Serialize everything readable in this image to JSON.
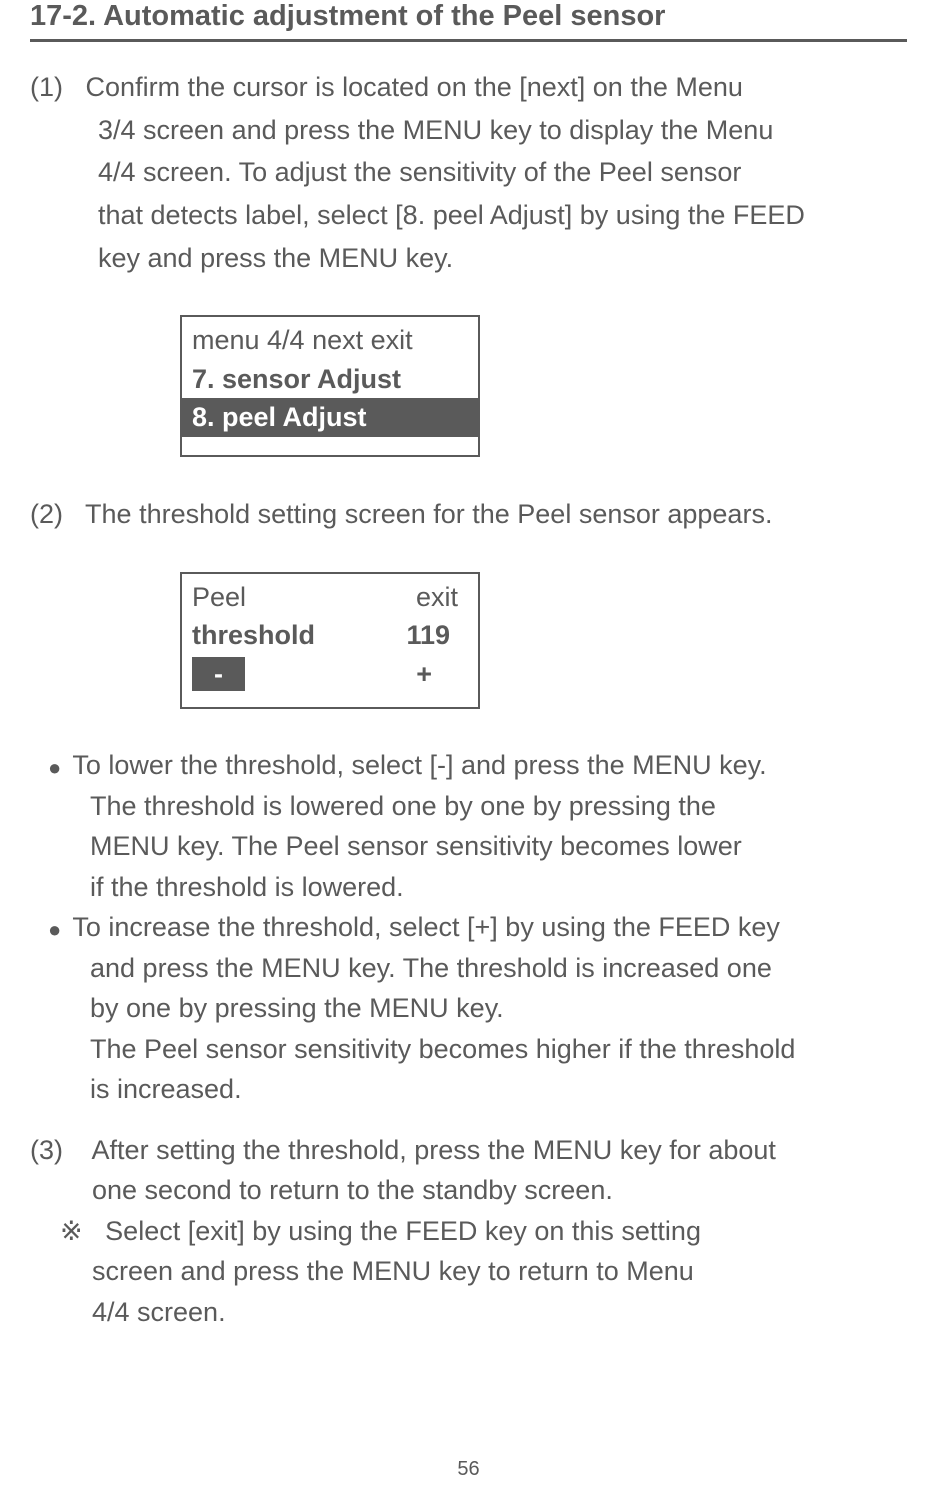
{
  "heading": "17-2.  Automatic adjustment of the Peel sensor",
  "step1": {
    "num": "(1)",
    "line1": "Confirm the cursor is located on the [next] on the  Menu",
    "line2": "3/4 screen and press the MENU key to display the Menu",
    "line3": "4/4 screen.  To adjust the sensitivity of the Peel sensor",
    "line4": "that detects label, select [8. peel Adjust] by using the FEED",
    "line5": "key and press the MENU key."
  },
  "screen1": {
    "row1": "menu 4/4 next   exit",
    "row2": "7. sensor Adjust",
    "row3": "8. peel Adjust"
  },
  "step2": {
    "num": "(2)",
    "line1": "The threshold setting screen for the Peel sensor appears."
  },
  "screen2": {
    "peel": "Peel",
    "exit": "exit",
    "threshold": "threshold",
    "value": "119",
    "minus": "-",
    "plus": "+"
  },
  "bullets": {
    "b1_l1": "To lower the threshold, select [-] and press the MENU key.",
    "b1_l2": "The threshold is lowered one by one by pressing the",
    "b1_l3": "MENU key.  The Peel sensor sensitivity becomes lower",
    "b1_l4": "if the threshold is lowered.",
    "b2_l1": "To increase the threshold, select [+] by using the FEED key",
    "b2_l2": "and press the MENU key. The threshold  is increased one",
    "b2_l3": "by one by pressing the MENU key.",
    "b2_l4": "The Peel sensor sensitivity becomes higher if the threshold",
    "b2_l5": "is increased."
  },
  "step3": {
    "num": "(3)",
    "line1": "After setting the threshold, press the MENU key for about",
    "line2": "one second to return to the standby screen.",
    "note_mark": "※",
    "note_l1": "Select [exit] by using the FEED key on this setting",
    "note_l2": "screen and press the MENU key to return to Menu",
    "note_l3": "4/4 screen."
  },
  "page_number": "56"
}
